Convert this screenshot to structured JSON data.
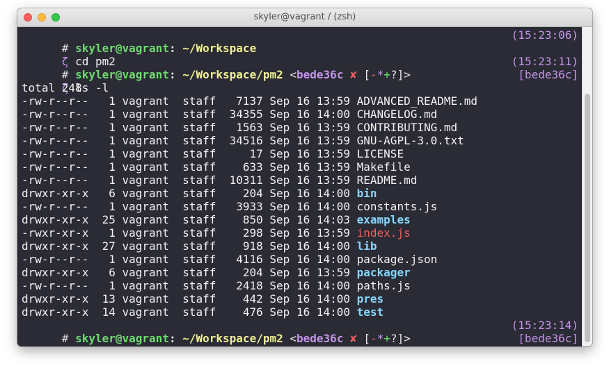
{
  "window": {
    "title": "skyler@vagrant / (zsh)"
  },
  "prompt": {
    "hash": "#",
    "user": "skyler",
    "at": "@",
    "host": "vagrant",
    "colon": ":",
    "zeta": "ζ"
  },
  "lines": {
    "p1_path": "~/Workspace",
    "p1_time": "(15:23:06)",
    "c1": "cd pm2",
    "p2_path": "~/Workspace/pm2",
    "p2_branch": "bede36c",
    "p2_x": "✘",
    "p2_time": "(15:23:11)",
    "c2": "ls -l",
    "c2_right": "[bede36c]",
    "total": "total 248",
    "p3_path": "~/Workspace/pm2",
    "p3_branch": "bede36c",
    "p3_x": "✘",
    "p3_time": "(15:23:14)",
    "c3_right": "[bede36c]"
  },
  "status_markers": {
    "open": "[",
    "minus": "-",
    "star": "*",
    "plus": "+",
    "q": "?",
    "close": "]>"
  },
  "listing": [
    {
      "prefix": "-rw-r--r--   1 vagrant  staff   7137 Sep 16 13:59 ",
      "name": "ADVANCED_README.md",
      "kind": "file"
    },
    {
      "prefix": "-rw-r--r--   1 vagrant  staff  34355 Sep 16 14:00 ",
      "name": "CHANGELOG.md",
      "kind": "file"
    },
    {
      "prefix": "-rw-r--r--   1 vagrant  staff   1563 Sep 16 13:59 ",
      "name": "CONTRIBUTING.md",
      "kind": "file"
    },
    {
      "prefix": "-rw-r--r--   1 vagrant  staff  34516 Sep 16 13:59 ",
      "name": "GNU-AGPL-3.0.txt",
      "kind": "file"
    },
    {
      "prefix": "-rw-r--r--   1 vagrant  staff     17 Sep 16 13:59 ",
      "name": "LICENSE",
      "kind": "file"
    },
    {
      "prefix": "-rw-r--r--   1 vagrant  staff    633 Sep 16 13:59 ",
      "name": "Makefile",
      "kind": "file"
    },
    {
      "prefix": "-rw-r--r--   1 vagrant  staff  10311 Sep 16 13:59 ",
      "name": "README.md",
      "kind": "file"
    },
    {
      "prefix": "drwxr-xr-x   6 vagrant  staff    204 Sep 16 14:00 ",
      "name": "bin",
      "kind": "dir"
    },
    {
      "prefix": "-rw-r--r--   1 vagrant  staff   3933 Sep 16 14:00 ",
      "name": "constants.js",
      "kind": "file"
    },
    {
      "prefix": "drwxr-xr-x  25 vagrant  staff    850 Sep 16 14:03 ",
      "name": "examples",
      "kind": "dir"
    },
    {
      "prefix": "-rwxr-xr-x   1 vagrant  staff    298 Sep 16 13:59 ",
      "name": "index.js",
      "kind": "exec"
    },
    {
      "prefix": "drwxr-xr-x  27 vagrant  staff    918 Sep 16 14:00 ",
      "name": "lib",
      "kind": "dir"
    },
    {
      "prefix": "-rw-r--r--   1 vagrant  staff   4116 Sep 16 14:00 ",
      "name": "package.json",
      "kind": "file"
    },
    {
      "prefix": "drwxr-xr-x   6 vagrant  staff    204 Sep 16 13:59 ",
      "name": "packager",
      "kind": "dir"
    },
    {
      "prefix": "-rw-r--r--   1 vagrant  staff   2418 Sep 16 14:00 ",
      "name": "paths.js",
      "kind": "file"
    },
    {
      "prefix": "drwxr-xr-x  13 vagrant  staff    442 Sep 16 14:00 ",
      "name": "pres",
      "kind": "dir"
    },
    {
      "prefix": "drwxr-xr-x  14 vagrant  staff    476 Sep 16 14:00 ",
      "name": "test",
      "kind": "dir"
    }
  ],
  "colors": {
    "background": "#2a2b35",
    "user": "#6fdb6f",
    "path": "#f1f192",
    "branch": "#c495ea",
    "error": "#f06060",
    "directory": "#87d7ff"
  }
}
